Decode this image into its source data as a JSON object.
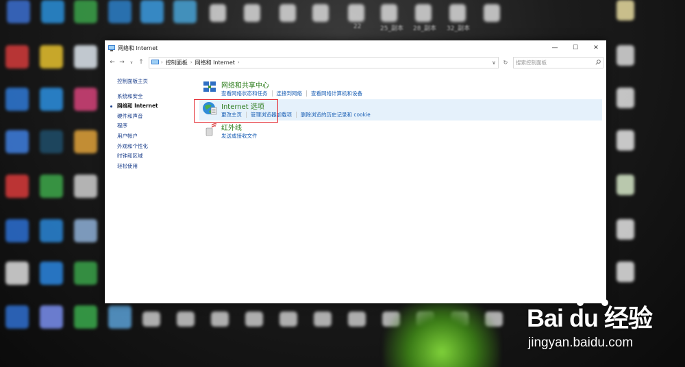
{
  "window": {
    "title": "网络和 Internet",
    "minimize": "—",
    "maximize": "☐",
    "close": "✕"
  },
  "address": {
    "crumbs": [
      "控制面板",
      "网络和 Internet"
    ],
    "search_placeholder": "搜索控制面板"
  },
  "sidebar": {
    "home": "控制面板主页",
    "items": [
      {
        "label": "系统和安全",
        "active": false
      },
      {
        "label": "网络和 Internet",
        "active": true
      },
      {
        "label": "硬件和声音",
        "active": false
      },
      {
        "label": "程序",
        "active": false
      },
      {
        "label": "用户帐户",
        "active": false
      },
      {
        "label": "外观和个性化",
        "active": false
      },
      {
        "label": "时钟和区域",
        "active": false
      },
      {
        "label": "轻松使用",
        "active": false
      }
    ]
  },
  "categories": [
    {
      "title": "网络和共享中心",
      "icon": "network-sharing-icon",
      "links": [
        "查看网络状态和任务",
        "连接到网络",
        "查看网络计算机和设备"
      ]
    },
    {
      "title": "Internet 选项",
      "icon": "internet-options-globe-icon",
      "links": [
        "更改主页",
        "管理浏览器加载项",
        "删除浏览的历史记录和 cookie"
      ]
    },
    {
      "title": "红外线",
      "icon": "infrared-icon",
      "links": [
        "发送或接收文件"
      ]
    }
  ],
  "desktop": {
    "labels": [
      "22",
      "25_副本",
      "28_副本",
      "32_副本"
    ]
  },
  "watermark": {
    "brand": "Bai du 经验",
    "url": "jingyan.baidu.com"
  },
  "colors": {
    "category_title": "#2d7d1c",
    "link": "#1a5fb4",
    "highlight": "#e5f1fb",
    "annotation_box": "#e3232b"
  }
}
